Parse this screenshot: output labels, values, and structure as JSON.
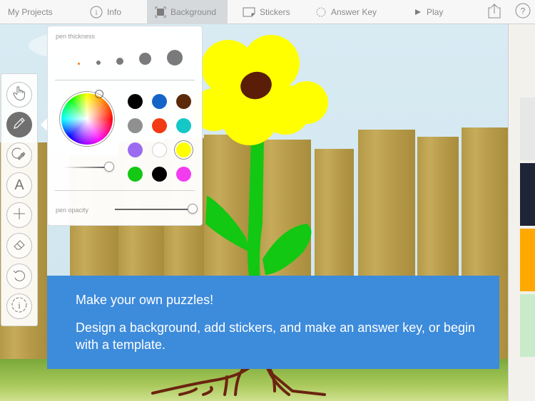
{
  "toolbar": {
    "tabs": [
      {
        "label": "My Projects",
        "icon": "none",
        "active": false
      },
      {
        "label": "Info",
        "icon": "info-circle-icon",
        "active": false
      },
      {
        "label": "Background",
        "icon": "background-frame-icon",
        "active": true
      },
      {
        "label": "Stickers",
        "icon": "sticker-icon",
        "active": false
      },
      {
        "label": "Answer Key",
        "icon": "answer-key-lasso-icon",
        "active": false
      },
      {
        "label": "Play",
        "icon": "play-triangle-icon",
        "active": false
      }
    ],
    "right_icons": [
      "share-icon",
      "help-icon"
    ],
    "help_glyph": "?",
    "info_glyph": "i"
  },
  "tool_palette": {
    "tools": [
      {
        "name": "hand-tool",
        "icon": "hand-pointer-icon",
        "active": false
      },
      {
        "name": "pen-tool",
        "icon": "pencil-icon",
        "active": true
      },
      {
        "name": "shape-tool",
        "icon": "shape-arrow-icon",
        "active": false
      },
      {
        "name": "text-tool",
        "icon": "text-a-icon",
        "glyph": "A",
        "active": false
      },
      {
        "name": "add-tool",
        "icon": "plus-icon",
        "active": false
      },
      {
        "name": "eraser-tool",
        "icon": "eraser-icon",
        "active": false
      },
      {
        "name": "undo-tool",
        "icon": "undo-icon",
        "active": false
      },
      {
        "name": "info-tool",
        "icon": "info-dashed-icon",
        "glyph": "i",
        "active": false
      }
    ]
  },
  "pen_popover": {
    "thickness_label": "pen thickness",
    "thickness_options": 5,
    "selected_thickness_index": 0,
    "selected_thickness_color": "#f07a1a",
    "colors": [
      "#000000",
      "#1464c8",
      "#5a2a0a",
      "#909090",
      "#f23a14",
      "#14c8c8",
      "#9b6cf0",
      "#ffffff",
      "#ffff00",
      "#14c814",
      "#000000",
      "#f23cf0"
    ],
    "selected_color_index": 8,
    "brightness_value": 1.0,
    "opacity_label": "pen opacity",
    "opacity_value": 1.0
  },
  "banner": {
    "title": "Make your own puzzles!",
    "body": "Design a background, add stickers, and make an answer key, or begin with a template."
  },
  "right_rail": {
    "swatches": [
      "#e6e7e7",
      "#1e2536",
      "#ffa800",
      "#c9ebc9"
    ]
  }
}
